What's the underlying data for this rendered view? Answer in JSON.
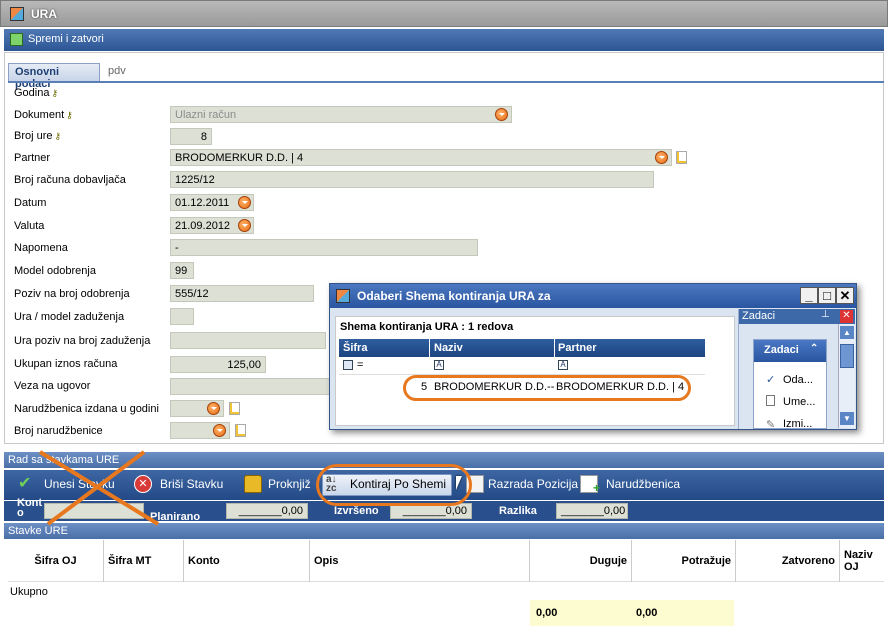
{
  "window": {
    "title": "URA"
  },
  "toolbar": {
    "save_close": "Spremi i zatvori"
  },
  "tabs": [
    {
      "label": "Osnovni podaci"
    },
    {
      "label": "pdv"
    }
  ],
  "form": {
    "godina": {
      "label": "Godina"
    },
    "dokument": {
      "label": "Dokument",
      "value": "Ulazni račun"
    },
    "broj_ure": {
      "label": "Broj ure",
      "value": "8"
    },
    "partner": {
      "label": "Partner",
      "value": "BRODOMERKUR D.D. | 4"
    },
    "broj_racuna": {
      "label": "Broj računa dobavljača",
      "value": "1225/12"
    },
    "datum": {
      "label": "Datum",
      "value": "01.12.2011"
    },
    "valuta": {
      "label": "Valuta",
      "value": "21.09.2012"
    },
    "napomena": {
      "label": "Napomena",
      "value": "-"
    },
    "model_odobrenja": {
      "label": "Model odobrenja",
      "value": "99"
    },
    "poziv_odobrenja": {
      "label": "Poziv na broj odobrenja",
      "value": "555/12"
    },
    "model_zaduzenja": {
      "label": "Ura / model zaduženja",
      "value": ""
    },
    "poziv_zaduzenja": {
      "label": "Ura poziv na broj zaduženja",
      "value": ""
    },
    "ukupan_iznos": {
      "label": "Ukupan iznos računa",
      "value": "125,00"
    },
    "veza_ugovor": {
      "label": "Veza na ugovor",
      "value": ""
    },
    "narudzbenica_godina": {
      "label": "Narudžbenica izdana u godini",
      "value": ""
    },
    "broj_narudzbenice": {
      "label": "Broj narudžbenice",
      "value": ""
    }
  },
  "rad_section": {
    "title": "Rad sa stavkama URE"
  },
  "actions": {
    "unesi": "Unesi Stavku",
    "brisi": "Briši Stavku",
    "proknjizi": "Proknjiž",
    "kontiraj": "Kontiraj Po Shemi",
    "razrada": "Razrada Pozicija",
    "narudzbenica": "Narudžbenica"
  },
  "summary": {
    "konto_label": "Kont o",
    "planirano_label": "Planirano",
    "planirano_value": "_______0,00",
    "izvrseno_label": "Izvršeno",
    "izvrseno_value": "_______0,00",
    "razlika_label": "Razlika",
    "razlika_value": "_______0,00"
  },
  "stavke": {
    "title": "Stavke URE",
    "columns": {
      "sifra_oj": "Šifra OJ",
      "sifra_mt": "Šifra MT",
      "konto": "Konto",
      "opis": "Opis",
      "duguje": "Duguje",
      "potrazuje": "Potražuje",
      "zatvoreno": "Zatvoreno",
      "naziv_oj": "Naziv OJ"
    },
    "ukupno_label": "Ukupno",
    "duguje_total": "0,00",
    "potrazuje_total": "0,00"
  },
  "dialog": {
    "title": "Odaberi Shema kontiranja URA  za",
    "list_title": "Shema kontiranja URA : 1 redova",
    "columns": [
      "Šifra",
      "Naziv",
      "Partner"
    ],
    "filter_op": "=",
    "row": {
      "sifra": "5",
      "naziv": "BRODOMERKUR D.D.--",
      "partner": "BRODOMERKUR D.D. | 4"
    }
  },
  "zadaci": {
    "panel_title": "Zadaci",
    "group_title": "Zadaci",
    "items": [
      "Oda...",
      "Ume...",
      "Izmi..."
    ]
  },
  "colors": {
    "accent": "#2d5594",
    "annotation": "#e8781e",
    "field_bg": "#dde0d5"
  }
}
